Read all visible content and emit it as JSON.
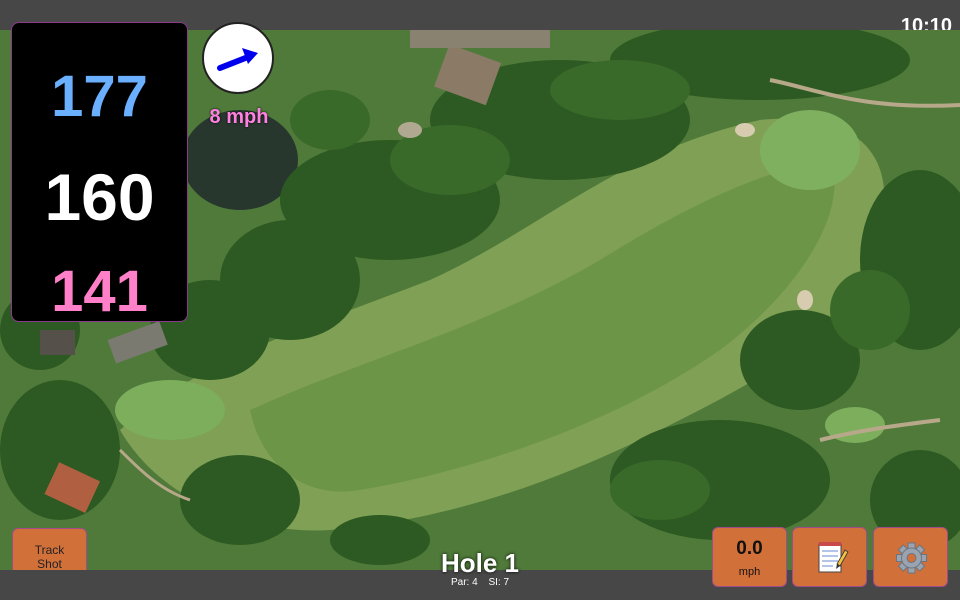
{
  "status": {
    "time": "10:10"
  },
  "distances": {
    "back": "177",
    "middle": "160",
    "front": "141"
  },
  "wind": {
    "speed": "8 mph",
    "direction_icon": "arrow-icon"
  },
  "track_shot": {
    "line1": "Track",
    "line2": "Shot"
  },
  "hole": {
    "title": "Hole 1",
    "par": "Par: 4",
    "si": "SI: 7"
  },
  "speed": {
    "value": "0.0",
    "unit": "mph"
  },
  "icons": {
    "notes": "notepad-icon",
    "settings": "gear-icon"
  },
  "colors": {
    "back": "#6ab0ff",
    "middle": "#ffffff",
    "front": "#ff80c8",
    "button": "#d2703a",
    "wind_text": "#ff80e0",
    "arrow": "#0000ee"
  }
}
